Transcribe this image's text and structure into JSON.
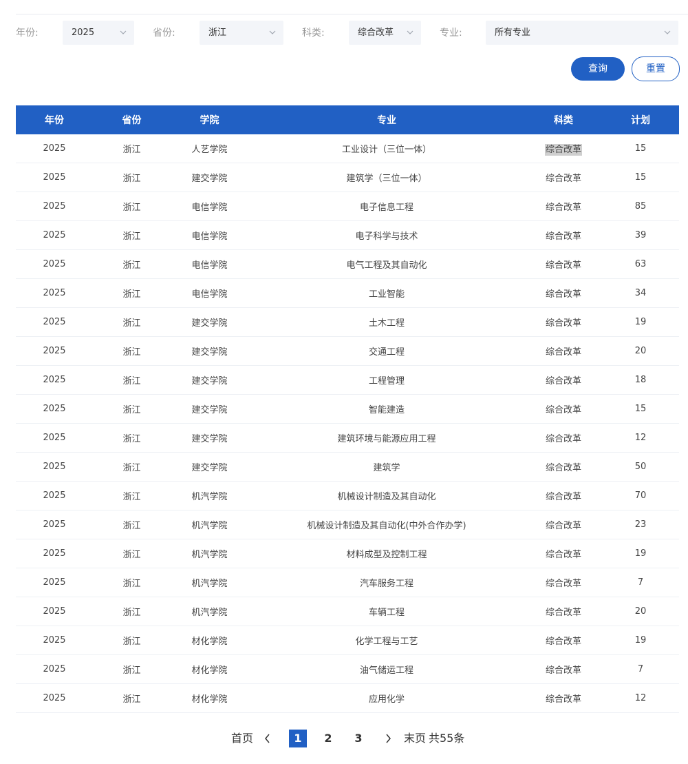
{
  "filters": {
    "year_label": "年份:",
    "year_value": "2025",
    "province_label": "省份:",
    "province_value": "浙江",
    "category_label": "科类:",
    "category_value": "综合改革",
    "major_label": "专业:",
    "major_value": "所有专业"
  },
  "buttons": {
    "query": "查询",
    "reset": "重置"
  },
  "table": {
    "headers": [
      "年份",
      "省份",
      "学院",
      "专业",
      "科类",
      "计划"
    ],
    "rows": [
      [
        "2025",
        "浙江",
        "人艺学院",
        "工业设计（三位一体）",
        "综合改革",
        "15"
      ],
      [
        "2025",
        "浙江",
        "建交学院",
        "建筑学（三位一体）",
        "综合改革",
        "15"
      ],
      [
        "2025",
        "浙江",
        "电信学院",
        "电子信息工程",
        "综合改革",
        "85"
      ],
      [
        "2025",
        "浙江",
        "电信学院",
        "电子科学与技术",
        "综合改革",
        "39"
      ],
      [
        "2025",
        "浙江",
        "电信学院",
        "电气工程及其自动化",
        "综合改革",
        "63"
      ],
      [
        "2025",
        "浙江",
        "电信学院",
        "工业智能",
        "综合改革",
        "34"
      ],
      [
        "2025",
        "浙江",
        "建交学院",
        "土木工程",
        "综合改革",
        "19"
      ],
      [
        "2025",
        "浙江",
        "建交学院",
        "交通工程",
        "综合改革",
        "20"
      ],
      [
        "2025",
        "浙江",
        "建交学院",
        "工程管理",
        "综合改革",
        "18"
      ],
      [
        "2025",
        "浙江",
        "建交学院",
        "智能建造",
        "综合改革",
        "15"
      ],
      [
        "2025",
        "浙江",
        "建交学院",
        "建筑环境与能源应用工程",
        "综合改革",
        "12"
      ],
      [
        "2025",
        "浙江",
        "建交学院",
        "建筑学",
        "综合改革",
        "50"
      ],
      [
        "2025",
        "浙江",
        "机汽学院",
        "机械设计制造及其自动化",
        "综合改革",
        "70"
      ],
      [
        "2025",
        "浙江",
        "机汽学院",
        "机械设计制造及其自动化(中外合作办学)",
        "综合改革",
        "23"
      ],
      [
        "2025",
        "浙江",
        "机汽学院",
        "材料成型及控制工程",
        "综合改革",
        "19"
      ],
      [
        "2025",
        "浙江",
        "机汽学院",
        "汽车服务工程",
        "综合改革",
        "7"
      ],
      [
        "2025",
        "浙江",
        "机汽学院",
        "车辆工程",
        "综合改革",
        "20"
      ],
      [
        "2025",
        "浙江",
        "材化学院",
        "化学工程与工艺",
        "综合改革",
        "19"
      ],
      [
        "2025",
        "浙江",
        "材化学院",
        "油气储运工程",
        "综合改革",
        "7"
      ],
      [
        "2025",
        "浙江",
        "材化学院",
        "应用化学",
        "综合改革",
        "12"
      ]
    ]
  },
  "pagination": {
    "first": "首页",
    "pages": [
      "1",
      "2",
      "3"
    ],
    "current_page": "1",
    "last": "末页",
    "total": "共55条"
  },
  "icons": {
    "select_arrow": "chevron-down-icon",
    "prev": "chevron-left-icon",
    "next": "chevron-right-icon"
  },
  "colors": {
    "primary": "#2160c4",
    "select_bg": "#f3f5f9",
    "highlight": "#cfcfcf"
  }
}
